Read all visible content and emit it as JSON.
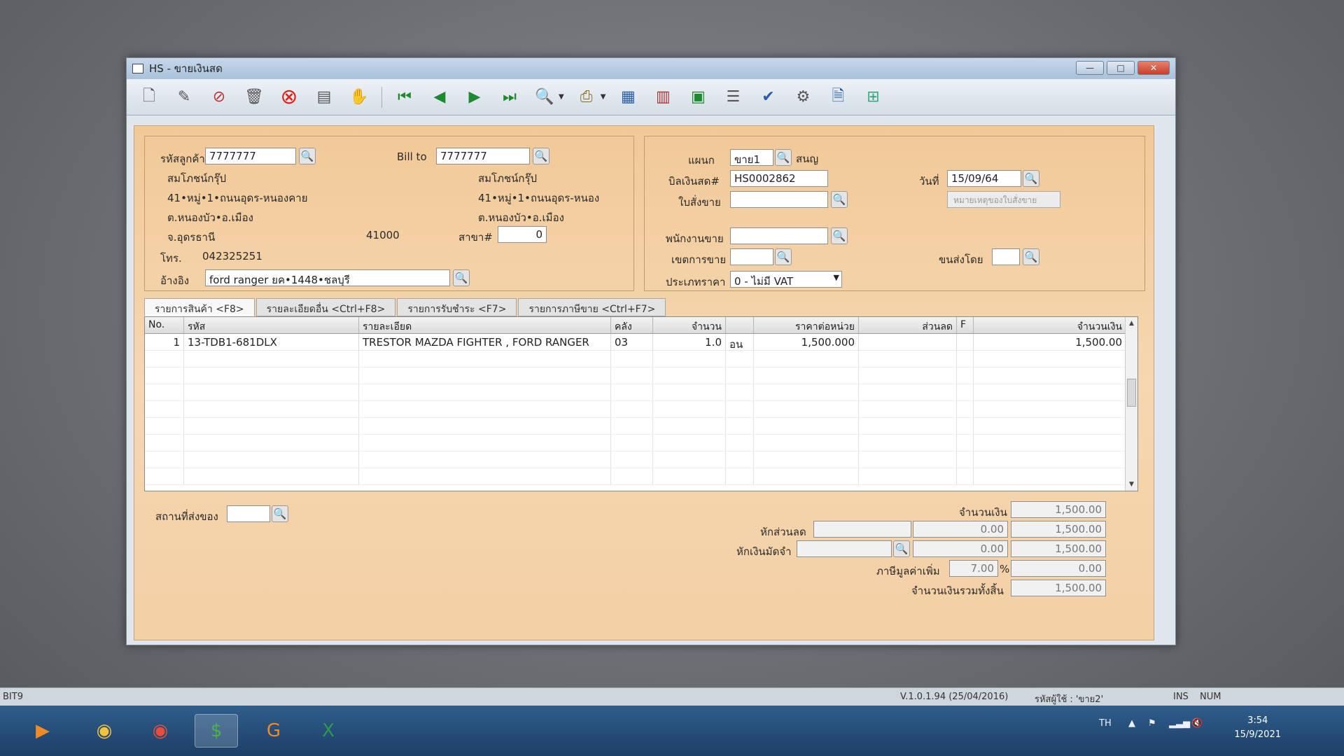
{
  "window": {
    "title": "HS - ขายเงินสด",
    "controls": {
      "minimize": "—",
      "maximize": "□",
      "close": "✕"
    }
  },
  "toolbar": {
    "icons": [
      "new-doc-icon",
      "edit-icon",
      "void-icon",
      "delete-icon",
      "cancel-icon",
      "save-icon",
      "handshake-icon",
      "first-record-icon",
      "prev-record-icon",
      "next-record-icon",
      "last-record-icon",
      "search-doc-icon",
      "print-icon",
      "calculator-icon",
      "register-icon",
      "so-icon",
      "report-icon",
      "approve-ok-icon",
      "link-icon",
      "doc-ok-icon",
      "network-icon"
    ]
  },
  "customer": {
    "code_label": "รหัสลูกค้า",
    "code": "7777777",
    "name": "สมโภชน์กรุ๊ป",
    "address1": "41•หมู่•1•ถนนอุดร-หนองคาย",
    "address2": "ต.หนองบัว•อ.เมือง",
    "province": "จ.อุดรธานี",
    "postcode": "41000",
    "phone_label": "โทร.",
    "phone": "042325251",
    "ref_label": "อ้างอิง",
    "ref": "ford ranger ยค•1448•ชลบุรี",
    "branch_label": "สาขา#",
    "branch": "0"
  },
  "bill_to": {
    "label": "Bill to",
    "code": "7777777",
    "name": "สมโภชน์กรุ๊ป",
    "address1": "41•หมู่•1•ถนนอุดร-หนอง",
    "address2": "ต.หนองบัว•อ.เมือง"
  },
  "doc": {
    "dept_label": "แผนก",
    "dept": "ขาย1",
    "dept_name": "สนญ",
    "bill_label": "บิลเงินสด#",
    "bill_no": "HS0002862",
    "date_label": "วันที่",
    "date": "15/09/64",
    "order_label": "ใบสั่งขาย",
    "order_no": "",
    "order_note_btn": "หมายเหตุของใบสั่งขาย",
    "sales_label": "พนักงานขาย",
    "sales": "",
    "area_label": "เขตการขาย",
    "area": "",
    "ship_label": "ขนส่งโดย",
    "ship": "",
    "price_type_label": "ประเภทราคา",
    "price_type": "0 - ไม่มี VAT"
  },
  "tabs": [
    "รายการสินค้า <F8>",
    "รายละเอียดอื่น <Ctrl+F8>",
    "รายการรับชำระ <F7>",
    "รายการภาษีขาย <Ctrl+F7>"
  ],
  "grid": {
    "headers": [
      "No.",
      "รหัส",
      "รายละเอียด",
      "คลัง",
      "จำนวน",
      "",
      "ราคาต่อหน่วย",
      "ส่วนลด",
      "F",
      "จำนวนเงิน"
    ],
    "rows": [
      [
        "1",
        "13-TDB1-681DLX",
        "TRESTOR MAZDA FIGHTER , FORD RANGER",
        "03",
        "1.0",
        "อน",
        "1,500.000",
        "",
        "",
        "1,500.00"
      ]
    ]
  },
  "footer": {
    "delivery_label": "สถานที่ส่งของ",
    "delivery": "",
    "amount_label": "จำนวนเงิน",
    "amount": "1,500.00",
    "discount_label": "หักส่วนลด",
    "discount_input": "",
    "discount": "0.00",
    "after_discount": "1,500.00",
    "deposit_label": "หักเงินมัดจำ",
    "deposit_input": "",
    "deposit": "0.00",
    "after_deposit": "1,500.00",
    "vat_label": "ภาษีมูลค่าเพิ่ม",
    "vat_rate": "7.00",
    "vat_pct": "%",
    "vat_amount": "0.00",
    "total_label": "จำนวนเงินรวมทั้งสิ้น",
    "total": "1,500.00"
  },
  "statusbar": {
    "left": "BIT9",
    "version": "V.1.0.1.94 (25/04/2016)",
    "user": "รหัสผู้ใช้ : 'ขาย2'",
    "ins": "INS",
    "num": "NUM"
  },
  "taskbar": {
    "lang": "TH",
    "time": "3:54",
    "date": "15/9/2021"
  }
}
